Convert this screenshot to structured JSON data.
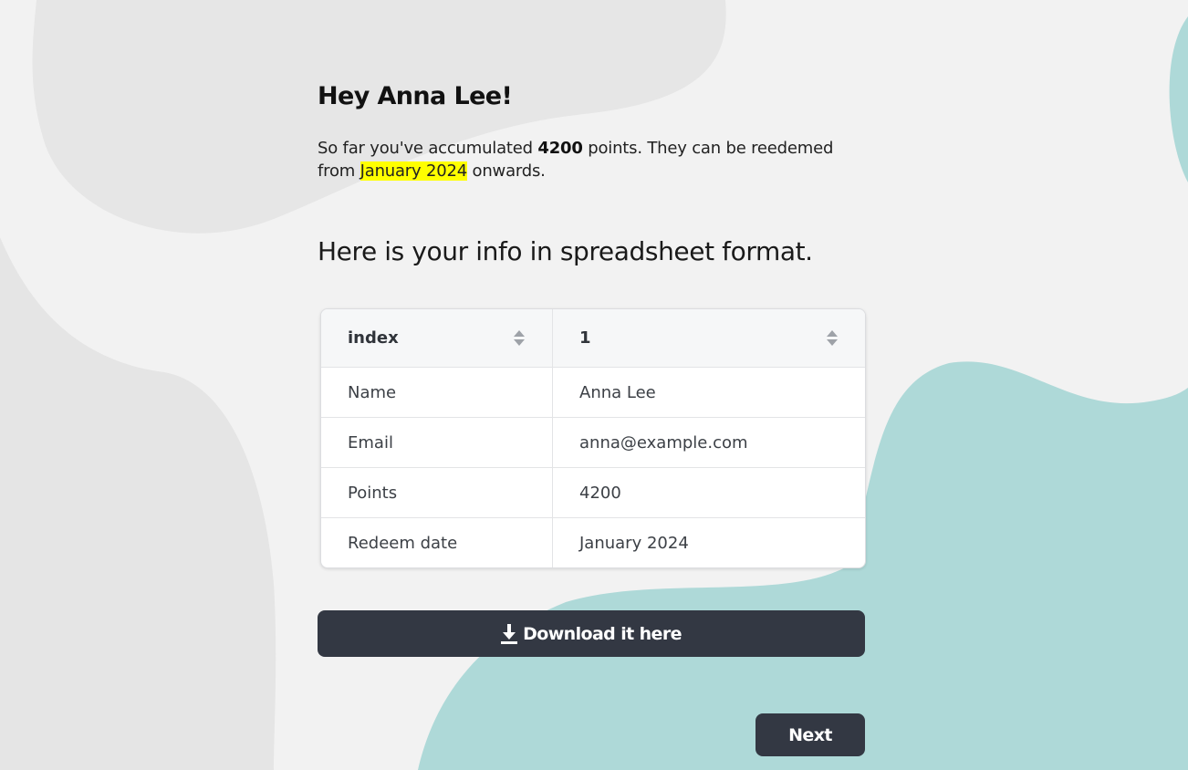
{
  "greeting": "Hey Anna Lee!",
  "intro": {
    "part1": "So far you've accumulated ",
    "points": "4200",
    "part2": " points. They can be reedemed from ",
    "redeem_date": "January 2024",
    "part3": " onwards."
  },
  "subheading": "Here is your info in spreadsheet format.",
  "table": {
    "headers": [
      "index",
      "1"
    ],
    "rows": [
      [
        "Name",
        "Anna Lee"
      ],
      [
        "Email",
        "anna@example.com"
      ],
      [
        "Points",
        "4200"
      ],
      [
        "Redeem date",
        "January 2024"
      ]
    ]
  },
  "download_button": {
    "label": "Download it here",
    "icon": "download-icon"
  },
  "next_button": {
    "label": "Next"
  },
  "colors": {
    "background": "#f2f2f2",
    "accent_blob": "#aed9d8",
    "button": "#333843",
    "highlight": "#ffff00"
  }
}
